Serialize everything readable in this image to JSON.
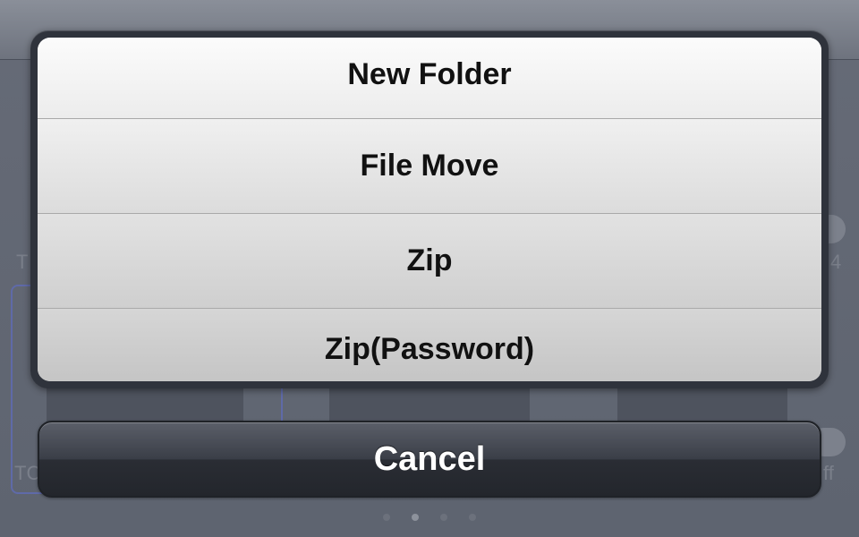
{
  "action_sheet": {
    "options": [
      {
        "label": "New Folder"
      },
      {
        "label": "File Move"
      },
      {
        "label": "Zip"
      },
      {
        "label": "Zip(Password)"
      }
    ],
    "cancel_label": "Cancel"
  },
  "background": {
    "fragments": [
      "T",
      "4",
      "TC",
      "ff"
    ],
    "page_indicator": {
      "count": 4,
      "active_index": 1
    }
  },
  "colors": {
    "sheet_frame": "#2f333c",
    "option_text": "#111111",
    "cancel_bg": "#2a2d34",
    "cancel_text": "#ffffff",
    "dim_overlay": "#5c6270"
  }
}
